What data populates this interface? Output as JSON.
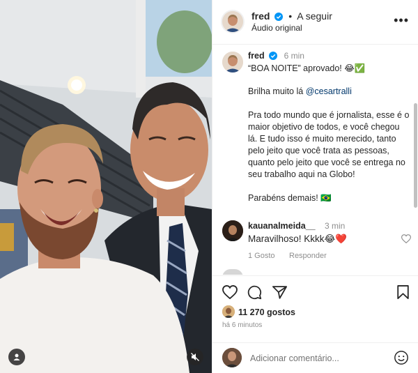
{
  "post": {
    "username": "fred",
    "follow_label": "A seguir",
    "audio_label": "Áudio original",
    "more_label": "•••"
  },
  "caption": {
    "username": "fred",
    "time": "6 min",
    "line1": "“BOA NOITE” aprovado! 😂✅",
    "line2_prefix": "Brilha muito lá ",
    "line2_mention": "@cesartralli",
    "line3": "Pra todo mundo que é jornalista, esse é o maior objetivo de todos, e você chegou lá. E tudo isso é muito merecido, tanto pelo jeito que você trata as pessoas, quanto pelo jeito que você se entrega no seu trabalho aqui na Globo!",
    "line4": "Parabéns demais! 🇧🇷"
  },
  "comment": {
    "username": "kauanalmeida__",
    "time": "3 min",
    "text": "Maravilhoso! Kkkk😂❤️",
    "likes": "1 Gosto",
    "reply_label": "Responder"
  },
  "actions": {
    "likes_count": "11 270 gostos",
    "posted_time": "há 6 minutos"
  },
  "add_comment": {
    "placeholder": "Adicionar comentário..."
  },
  "colors": {
    "verified": "#0095f6",
    "mention": "#00376b",
    "heart": "#ed4956"
  },
  "icons": [
    "verified-icon",
    "more-icon",
    "heart-icon",
    "comment-icon",
    "share-icon",
    "save-icon",
    "emoji-icon",
    "user-tag-icon",
    "mute-icon"
  ]
}
